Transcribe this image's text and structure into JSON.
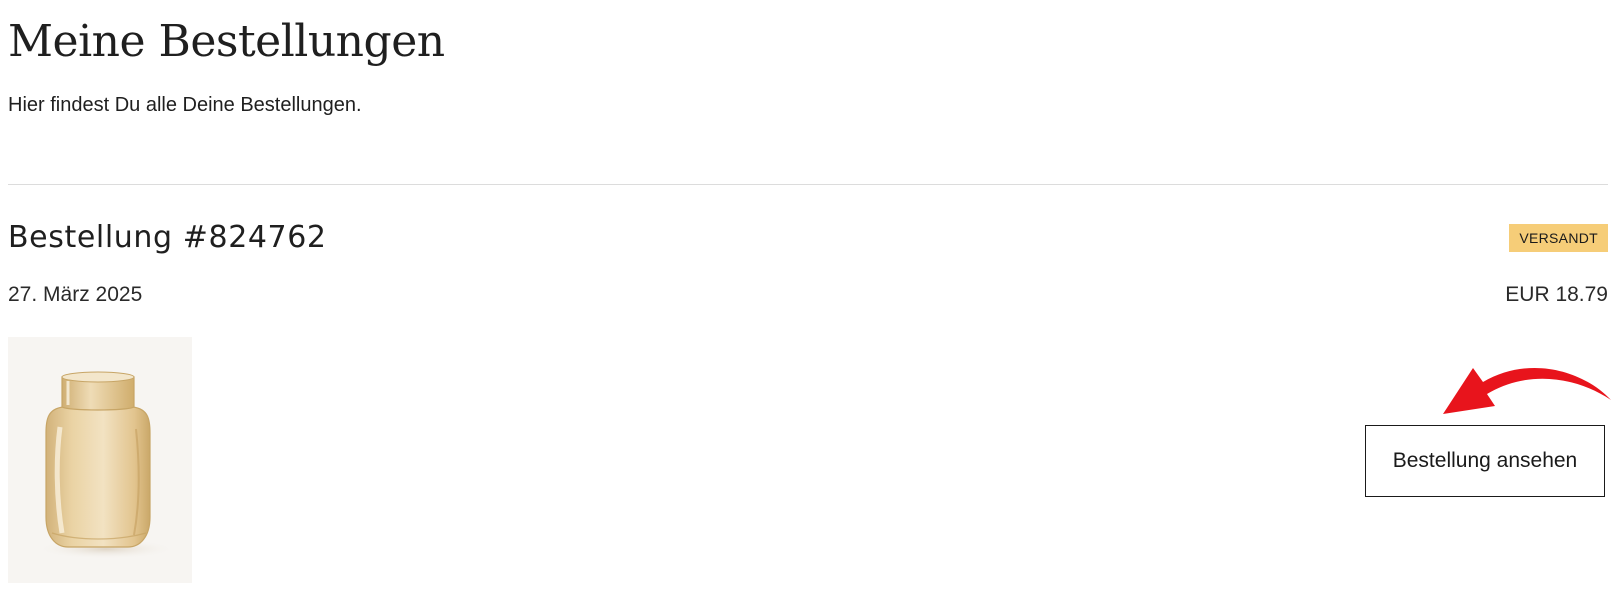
{
  "page": {
    "title": "Meine Bestellungen",
    "subtitle": "Hier findest Du alle Deine Bestellungen."
  },
  "orders": [
    {
      "number_label": "Bestellung #824762",
      "status": "VERSANDT",
      "date": "27. März 2025",
      "total": "EUR 18.79",
      "thumbnail_icon": "glass-vase-icon",
      "view_button_label": "Bestellung ansehen"
    }
  ],
  "colors": {
    "status_badge_bg": "#f6cd78",
    "annotation_arrow": "#e8141c",
    "divider": "#dcdcdc"
  },
  "icons": {
    "annotation": "curved-arrow-icon"
  }
}
